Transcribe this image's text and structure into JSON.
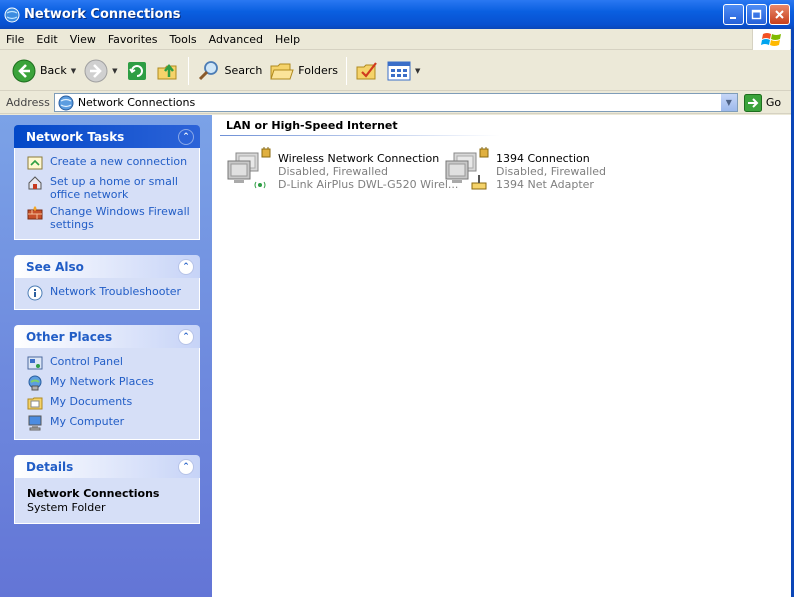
{
  "window": {
    "title": "Network Connections"
  },
  "menu": {
    "items": [
      "File",
      "Edit",
      "View",
      "Favorites",
      "Tools",
      "Advanced",
      "Help"
    ]
  },
  "toolbar": {
    "back_label": "Back",
    "search_label": "Search",
    "folders_label": "Folders"
  },
  "address": {
    "label": "Address",
    "value": "Network Connections",
    "go_label": "Go"
  },
  "sidebar": {
    "network_tasks": {
      "title": "Network Tasks",
      "items": [
        {
          "label": "Create a new connection",
          "icon": "new-connection-icon"
        },
        {
          "label": "Set up a home or small office network",
          "icon": "home-network-icon"
        },
        {
          "label": "Change Windows Firewall settings",
          "icon": "firewall-icon"
        }
      ]
    },
    "see_also": {
      "title": "See Also",
      "items": [
        {
          "label": "Network Troubleshooter",
          "icon": "info-icon"
        }
      ]
    },
    "other_places": {
      "title": "Other Places",
      "items": [
        {
          "label": "Control Panel",
          "icon": "control-panel-icon"
        },
        {
          "label": "My Network Places",
          "icon": "network-places-icon"
        },
        {
          "label": "My Documents",
          "icon": "documents-icon"
        },
        {
          "label": "My Computer",
          "icon": "computer-icon"
        }
      ]
    },
    "details": {
      "title": "Details",
      "name": "Network Connections",
      "type": "System Folder"
    }
  },
  "content": {
    "group_title": "LAN or High-Speed Internet",
    "connections": [
      {
        "name": "Wireless Network Connection",
        "status": "Disabled, Firewalled",
        "device": "D-Link AirPlus DWL-G520 Wirel..."
      },
      {
        "name": "1394 Connection",
        "status": "Disabled, Firewalled",
        "device": "1394 Net Adapter"
      }
    ]
  },
  "colors": {
    "titlebar": "#0A5FE0",
    "sidebar": "#6F8EE0",
    "link": "#215DC6",
    "chrome": "#ECE9D8"
  }
}
